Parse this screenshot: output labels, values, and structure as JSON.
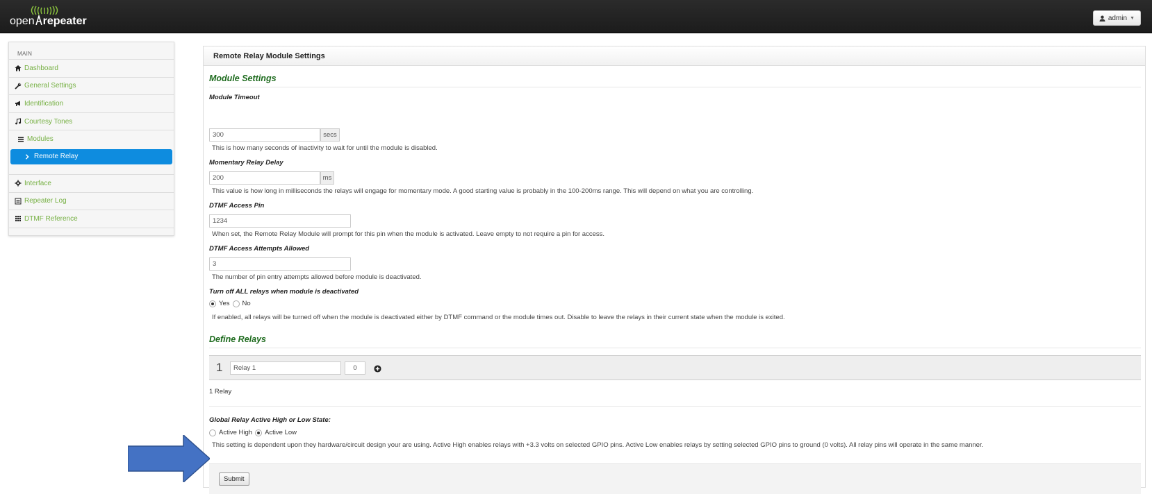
{
  "header": {
    "logo_prefix": "open",
    "logo_suffix": "repeater",
    "user_label": "admin"
  },
  "sidebar": {
    "section": "MAIN",
    "items": [
      {
        "label": "Dashboard",
        "icon": "home-icon"
      },
      {
        "label": "General Settings",
        "icon": "wrench-icon"
      },
      {
        "label": "Identification",
        "icon": "bullhorn-icon"
      },
      {
        "label": "Courtesy Tones",
        "icon": "music-icon"
      },
      {
        "label": "Modules",
        "icon": "list-icon"
      },
      {
        "label": "Remote Relay",
        "icon": "chevron-right-icon",
        "active": true
      },
      {
        "label": "Interface",
        "icon": "gear-icon"
      },
      {
        "label": "Repeater Log",
        "icon": "log-icon"
      },
      {
        "label": "DTMF Reference",
        "icon": "grid-icon"
      }
    ]
  },
  "panel": {
    "title": "Remote Relay Module Settings",
    "module_settings_title": "Module Settings",
    "timeout": {
      "label": "Module Timeout",
      "value": "300",
      "unit": "secs",
      "help": "This is how many seconds of inactivity to wait for until the module is disabled."
    },
    "delay": {
      "label": "Momentary Relay Delay",
      "value": "200",
      "unit": "ms",
      "help": "This value is how long in milliseconds the relays will engage for momentary mode. A good starting value is probably in the 100-200ms range. This will depend on what you are controlling."
    },
    "pin": {
      "label": "DTMF Access Pin",
      "value": "1234",
      "help": "When set, the Remote Relay Module will prompt for this pin when the module is activated. Leave empty to not require a pin for access."
    },
    "attempts": {
      "label": "DTMF Access Attempts Allowed",
      "value": "3",
      "help": "The number of pin entry attempts allowed before module is deactivated."
    },
    "turn_off": {
      "label": "Turn off ALL relays when module is deactivated",
      "yes": "Yes",
      "no": "No",
      "selected": "Yes",
      "help": "If enabled, all relays will be turned off when the module is deactivated either by DTMF command or the module times out. Disable to leave the relays in their current state when the module is exited."
    },
    "define_relays_title": "Define Relays",
    "relays": [
      {
        "number": "1",
        "name": "Relay 1",
        "gpio": "0"
      }
    ],
    "relay_count": "1 Relay",
    "global_state": {
      "label": "Global Relay Active High or Low State:",
      "high": "Active High",
      "low": "Active Low",
      "selected": "Active Low",
      "help": "This setting is dependent upon they hardware/circuit design your are using. Active High enables relays with +3.3 volts on selected GPIO pins. Active Low enables relays by setting selected GPIO pins to ground (0 volts). All relay pins will operate in the same manner."
    },
    "submit_label": "Submit"
  },
  "colors": {
    "accent_blue": "#0e8cdf",
    "link_green": "#76b043",
    "section_green": "#1e6b1e",
    "arrow_blue": "#4472c4"
  }
}
